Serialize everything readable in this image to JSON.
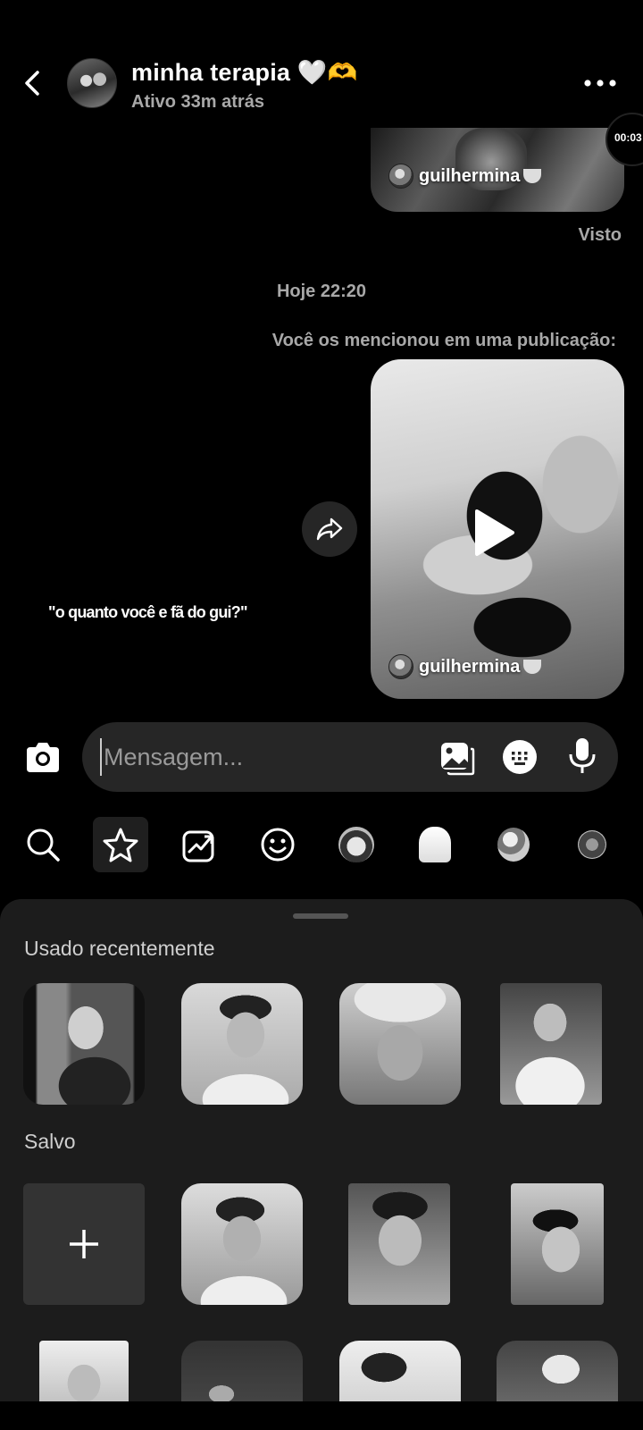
{
  "header": {
    "title": "minha terapia 🤍🫶",
    "status": "Ativo 33m atrás"
  },
  "messages": {
    "top_video_timer": "00:03",
    "top_mention_name": "guilhermina",
    "seen_label": "Visto",
    "date_separator": "Hoje 22:20",
    "mention_note": "Você os mencionou em uma publicação:",
    "post_mention_name": "guilhermina",
    "caption": "\"o quanto você e fã do gui?\""
  },
  "composer": {
    "placeholder": "Mensagem..."
  },
  "sticker_categories": [
    {
      "icon": "search-icon"
    },
    {
      "icon": "star-icon",
      "active": true
    },
    {
      "icon": "trending-icon"
    },
    {
      "icon": "smiley-icon"
    },
    {
      "icon": "sticker-pack-1"
    },
    {
      "icon": "sticker-pack-2"
    },
    {
      "icon": "sticker-pack-3"
    },
    {
      "icon": "sticker-pack-4"
    }
  ],
  "sheet": {
    "recent_title": "Usado recentemente",
    "saved_title": "Salvo"
  },
  "colors": {
    "background": "#000000",
    "sheet": "#1c1c1c",
    "input": "#262626",
    "muted_text": "#a8a8a8"
  }
}
